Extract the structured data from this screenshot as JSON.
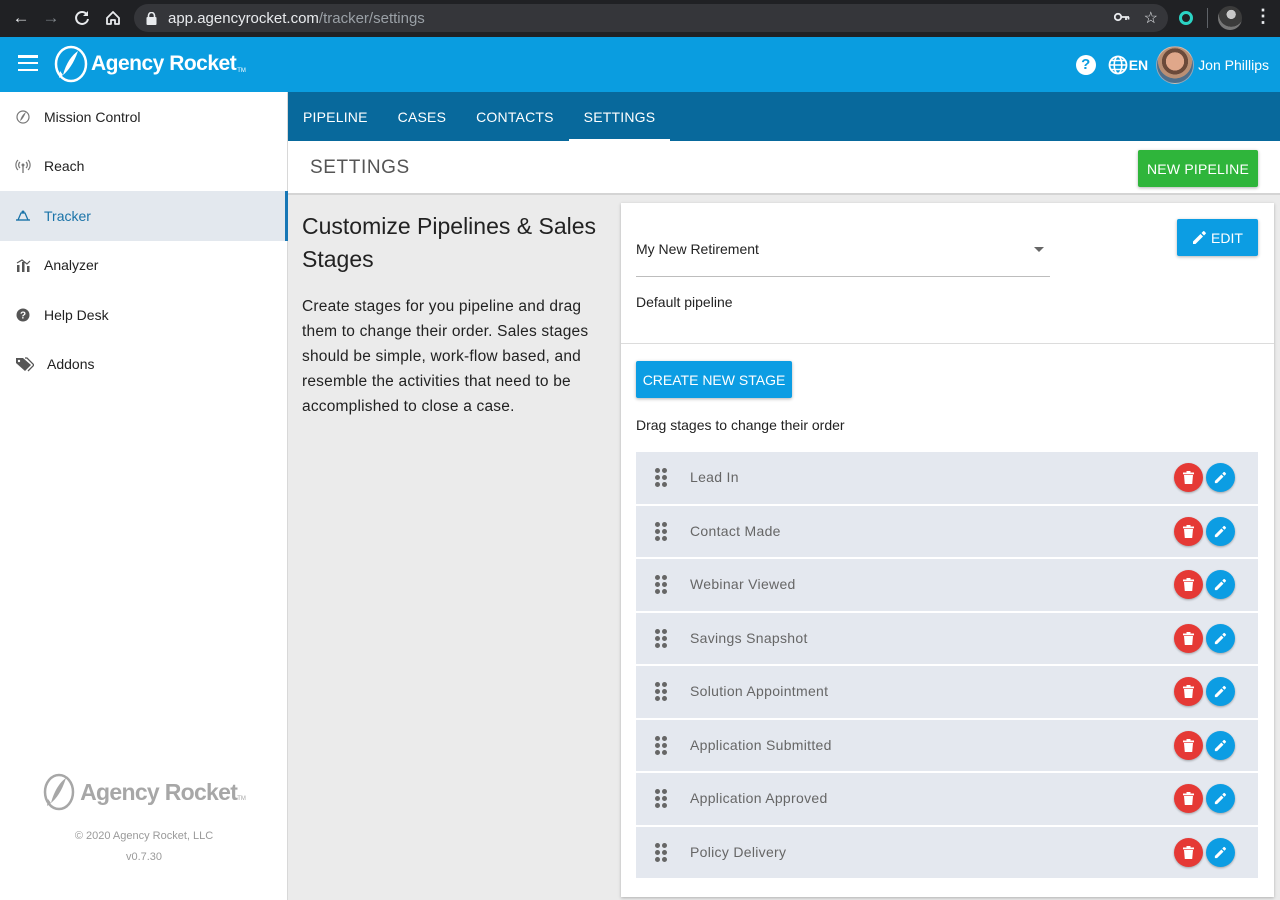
{
  "browser": {
    "url_host": "app.agencyrocket.com",
    "url_path": "/tracker/settings"
  },
  "header": {
    "logo_text": "Agency Rocket",
    "logo_tm": "TM",
    "lang": "EN",
    "user_name": "Jon Phillips"
  },
  "sidebar": {
    "items": [
      {
        "label": "Mission Control",
        "icon": "rocket-icon"
      },
      {
        "label": "Reach",
        "icon": "broadcast-icon"
      },
      {
        "label": "Tracker",
        "icon": "tracker-icon",
        "active": true
      },
      {
        "label": "Analyzer",
        "icon": "chart-icon"
      },
      {
        "label": "Help Desk",
        "icon": "help-icon"
      },
      {
        "label": "Addons",
        "icon": "tags-icon"
      }
    ],
    "footer_logo": "Agency Rocket",
    "footer_logo_tm": "TM",
    "copyright": "© 2020 Agency Rocket, LLC",
    "version": "v0.7.30"
  },
  "tabs": [
    {
      "label": "PIPELINE"
    },
    {
      "label": "CASES"
    },
    {
      "label": "CONTACTS"
    },
    {
      "label": "SETTINGS",
      "active": true
    }
  ],
  "settings_bar": {
    "title": "SETTINGS",
    "new_pipeline_label": "NEW PIPELINE"
  },
  "description": {
    "title": "Customize Pipelines & Sales Stages",
    "body": "Create stages for you pipeline and drag them to change their order. Sales stages should be simple, work-flow based, and resemble the activities that need to be accomplished to close a case."
  },
  "pipeline": {
    "selected": "My New Retirement",
    "edit_label": "EDIT",
    "default_label": "Default pipeline",
    "create_stage_label": "CREATE NEW STAGE",
    "drag_hint": "Drag stages to change their order",
    "stages": [
      {
        "name": "Lead In"
      },
      {
        "name": "Contact Made"
      },
      {
        "name": "Webinar Viewed"
      },
      {
        "name": "Savings Snapshot"
      },
      {
        "name": "Solution Appointment"
      },
      {
        "name": "Application Submitted"
      },
      {
        "name": "Application Approved"
      },
      {
        "name": "Policy Delivery"
      }
    ]
  },
  "colors": {
    "header_blue": "#0a9de0",
    "tab_blue": "#08699c",
    "green": "#2fb53b",
    "delete_red": "#e53935"
  }
}
